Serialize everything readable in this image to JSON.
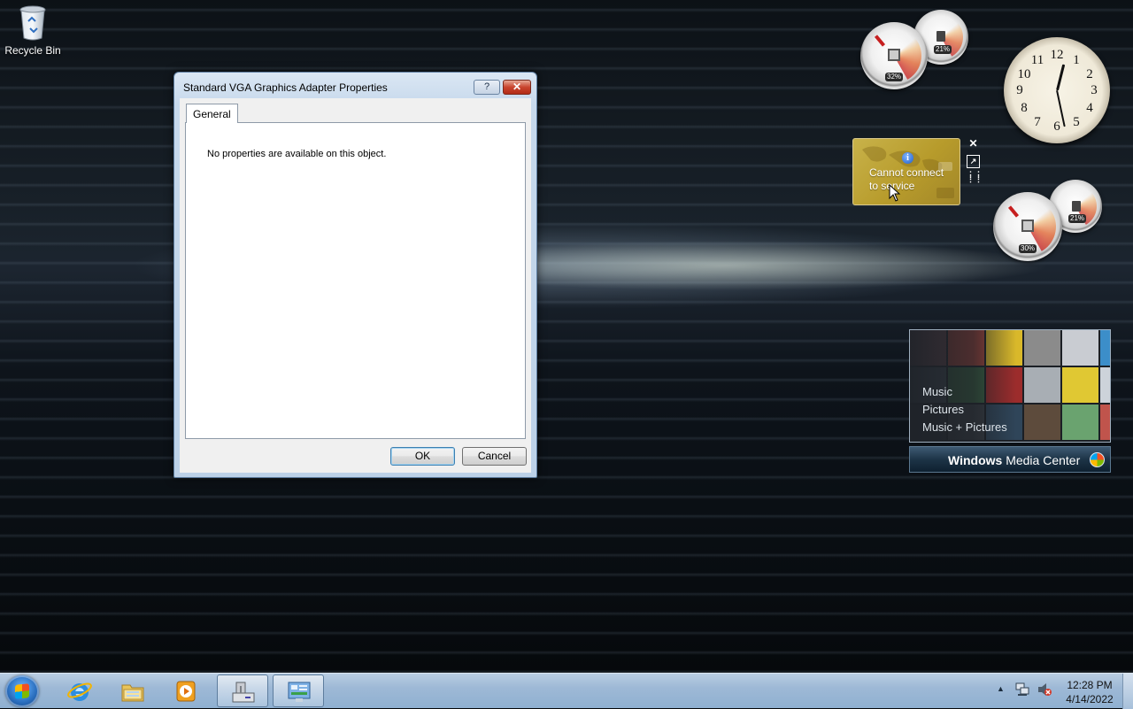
{
  "desktop": {
    "icons": [
      {
        "label": "Recycle Bin",
        "icon": "recycle-bin-icon"
      }
    ]
  },
  "dialog": {
    "title": "Standard VGA Graphics Adapter Properties",
    "help_label": "?",
    "close_label": "✕",
    "tabs": [
      {
        "label": "General",
        "selected": true
      }
    ],
    "message": "No properties are available on this object.",
    "ok_label": "OK",
    "cancel_label": "Cancel"
  },
  "gadgets": {
    "cpu_meter_1": {
      "cpu_percent": "32%",
      "memory_percent": "21%"
    },
    "cpu_meter_2": {
      "cpu_percent": "30%",
      "memory_percent": "21%"
    },
    "clock": {
      "time_hours": 12,
      "time_minutes": 28,
      "numbers": [
        "12",
        "1",
        "2",
        "3",
        "4",
        "5",
        "6",
        "7",
        "8",
        "9",
        "10",
        "11"
      ]
    },
    "weather": {
      "line1": "Cannot connect",
      "line2": "to service",
      "icon": "info-icon"
    },
    "media_center": {
      "items": [
        "Music",
        "Pictures",
        "Music + Pictures"
      ],
      "bar_label_bold": "Windows",
      "bar_label": " Media Center"
    }
  },
  "taskbar": {
    "start_icon": "windows-start-icon",
    "pinned": [
      {
        "name": "internet-explorer-icon"
      },
      {
        "name": "windows-explorer-icon"
      },
      {
        "name": "media-player-icon"
      },
      {
        "name": "device-manager-icon"
      },
      {
        "name": "control-panel-icon"
      }
    ],
    "tray": {
      "show_hidden_label": "▲",
      "time": "12:28 PM",
      "date": "4/14/2022"
    }
  },
  "colors": {
    "taskbar": "#9eb9d6",
    "dialog_frame": "#bcd1e8",
    "close_button": "#c9452e",
    "weather_bg": "#b79b2b"
  }
}
